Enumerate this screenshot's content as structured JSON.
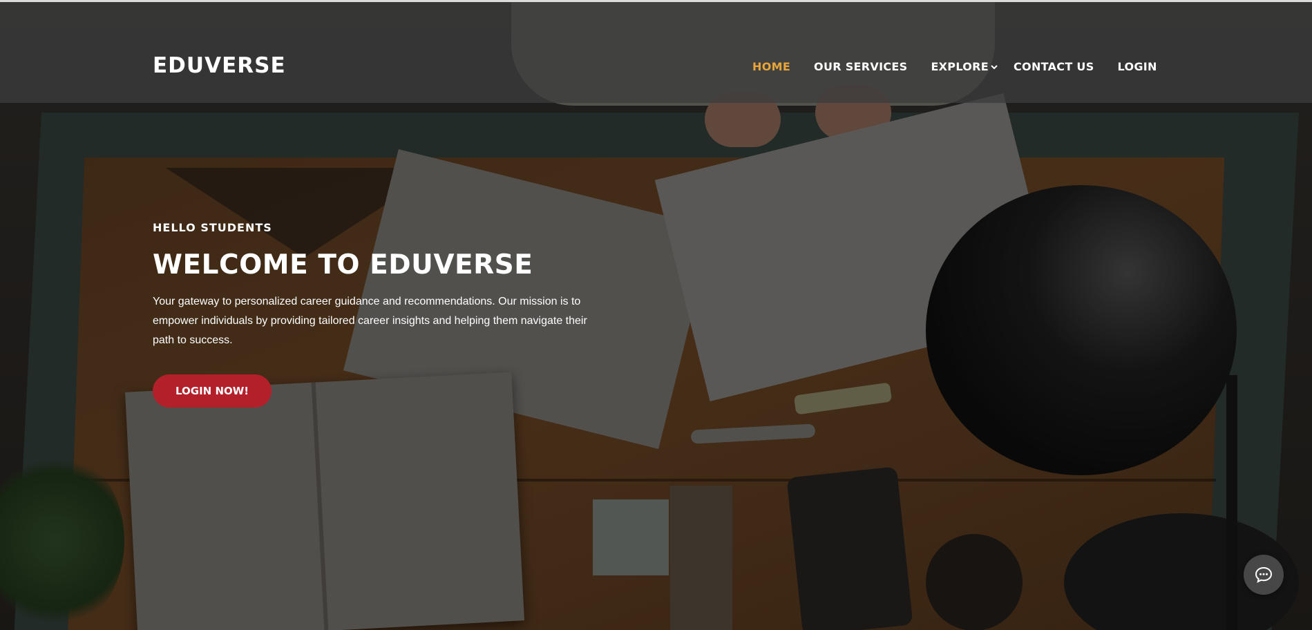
{
  "header": {
    "brand": "EDUVERSE",
    "nav": [
      {
        "label": "HOME",
        "active": true
      },
      {
        "label": "OUR SERVICES",
        "active": false
      },
      {
        "label": "EXPLORE",
        "active": false,
        "icon": "chevron-down-icon"
      },
      {
        "label": "CONTACT US",
        "active": false
      },
      {
        "label": "LOGIN",
        "active": false
      }
    ]
  },
  "hero": {
    "kicker": "HELLO STUDENTS",
    "headline": "WELCOME TO EDUVERSE",
    "description": "Your gateway to personalized career guidance and recommendations. Our mission is to empower individuals by providing tailored career insights and helping them navigate their path to success.",
    "cta_label": "LOGIN NOW!"
  },
  "chat_widget": {
    "icon": "chat-bubble-icon"
  },
  "colors": {
    "accent_active": "#e8a53a",
    "cta": "#b3202a",
    "header_bg": "#3c3c3c"
  }
}
